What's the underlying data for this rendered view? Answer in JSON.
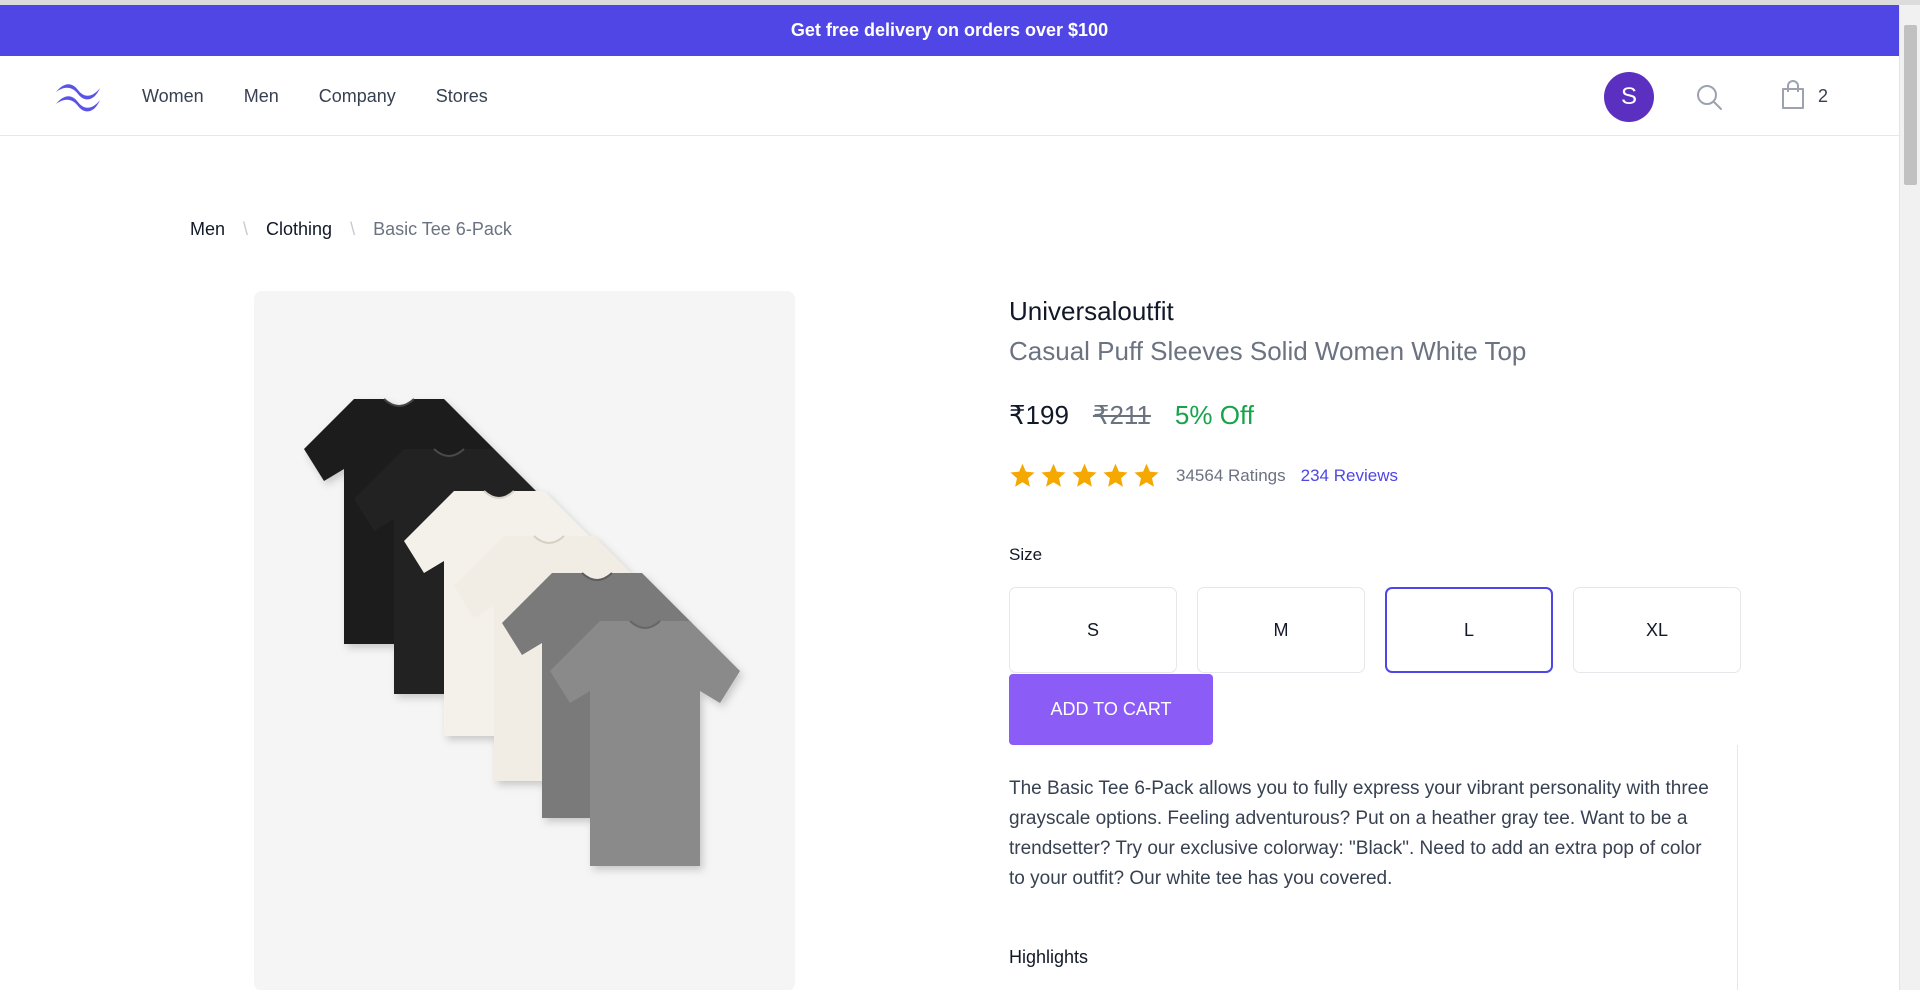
{
  "promo": {
    "text": "Get free delivery on orders over $100"
  },
  "nav": {
    "items": [
      "Women",
      "Men",
      "Company",
      "Stores"
    ]
  },
  "user": {
    "initial": "S",
    "avatar_color": "#5b2fc0"
  },
  "cart": {
    "count": "2"
  },
  "breadcrumb": {
    "items": [
      "Men",
      "Clothing"
    ],
    "current": "Basic Tee 6-Pack",
    "separator": "\\"
  },
  "product": {
    "brand": "Universaloutfit",
    "name": "Casual Puff Sleeves Solid Women White Top",
    "price": "₹199",
    "mrp": "₹211",
    "discount": "5% Off",
    "rating_stars": 5,
    "ratings_count": "34564 Ratings",
    "reviews": "234 Reviews",
    "size_label": "Size",
    "sizes": [
      "S",
      "M",
      "L",
      "XL"
    ],
    "selected_size": "L",
    "add_to_cart": "ADD TO CART",
    "description": "The Basic Tee 6-Pack allows you to fully express your vibrant personality with three grayscale options. Feeling adventurous? Put on a heather gray tee. Want to be a trendsetter? Try our exclusive colorway: \"Black\". Need to add an extra pop of color to your outfit? Our white tee has you covered.",
    "highlights_label": "Highlights"
  },
  "colors": {
    "accent": "#4f46e5",
    "button": "#8b5cf6",
    "discount": "#16a34a",
    "star": "#f5a800"
  },
  "icons": {
    "logo": "tailwind-wave-logo",
    "search": "search-icon",
    "bag": "shopping-bag-icon",
    "star": "star-icon"
  }
}
